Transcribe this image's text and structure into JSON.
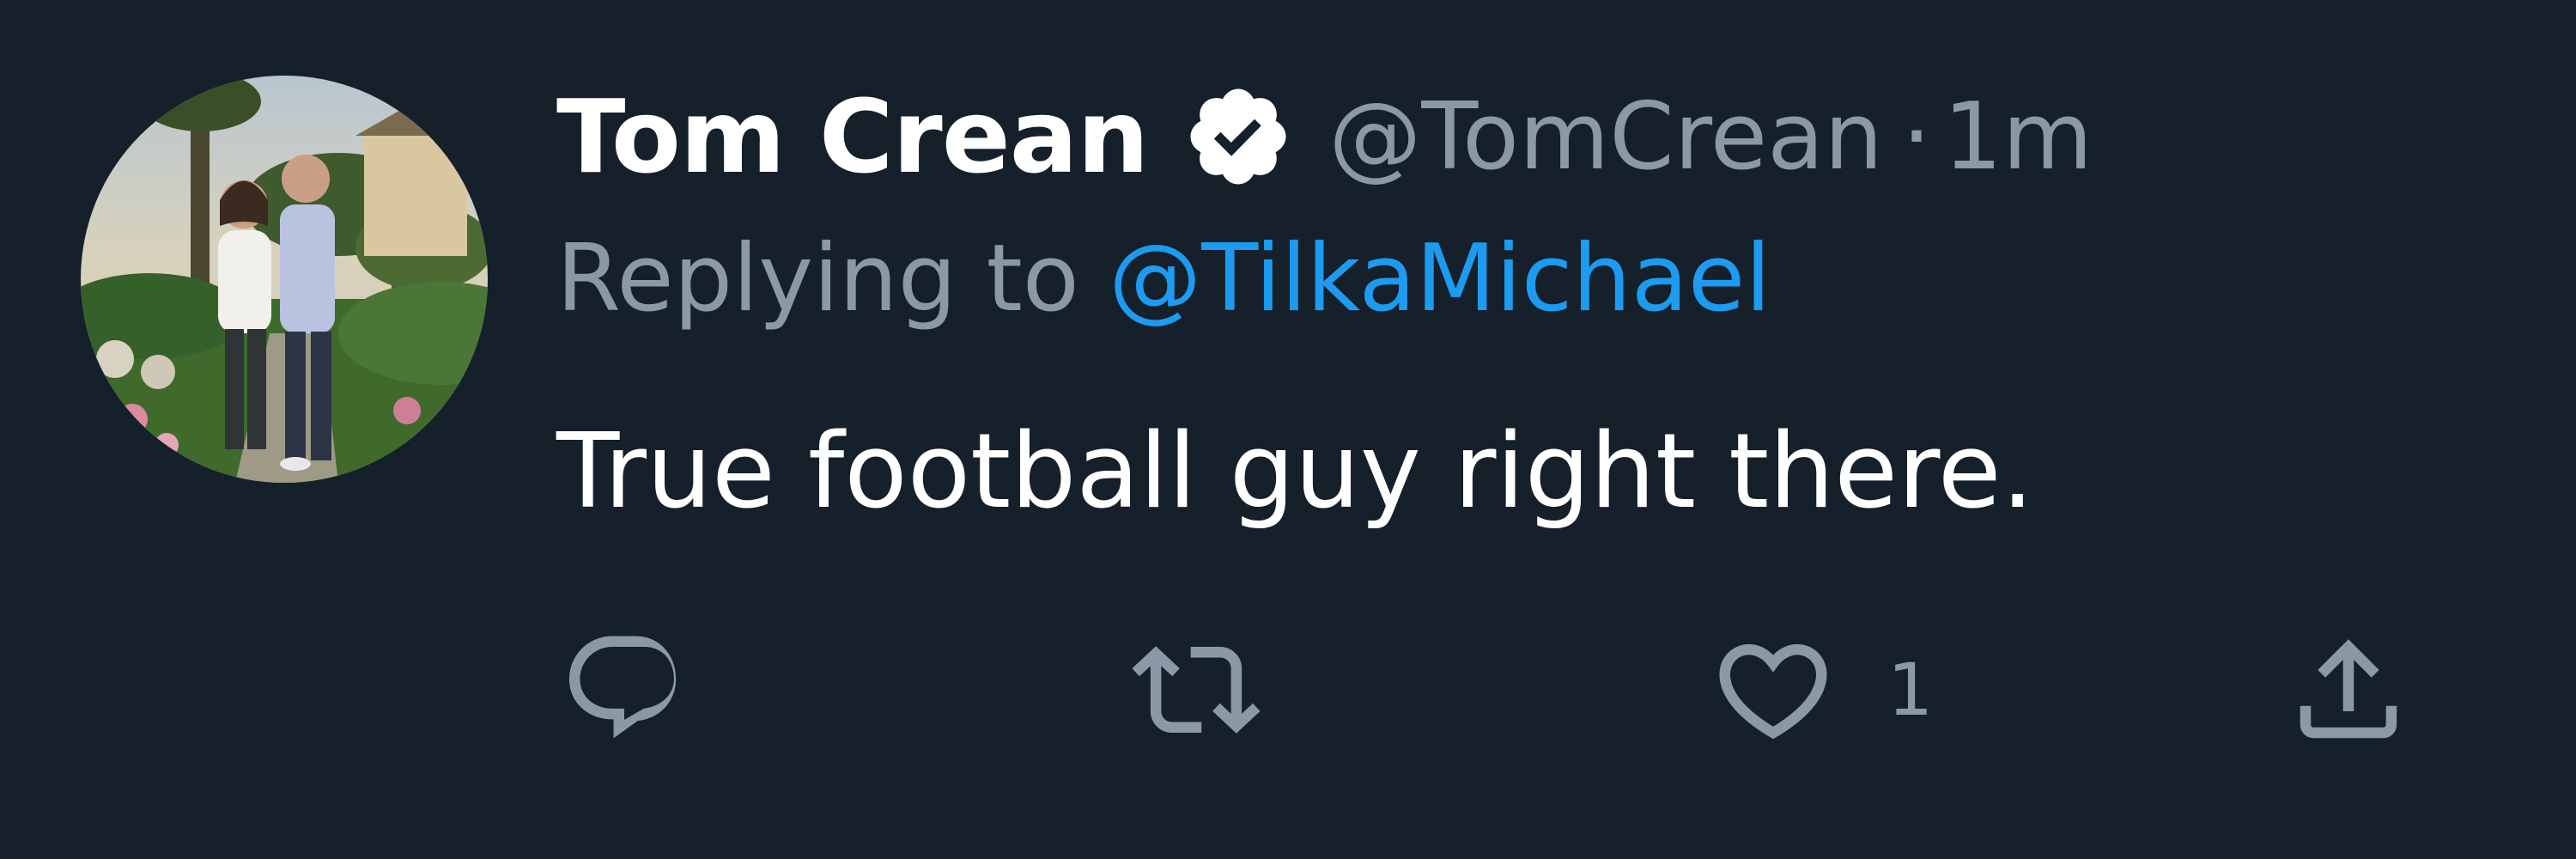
{
  "author": {
    "display_name": "Tom Crean",
    "handle": "@TomCrean",
    "separator": "·",
    "timestamp": "1m",
    "verified": true,
    "avatar": "photo of two people standing outdoors with palm trees"
  },
  "reply": {
    "prefix": "Replying to",
    "mention": "@TilkaMichael"
  },
  "tweet": {
    "text": "True football guy right there."
  },
  "actions": [
    {
      "name": "reply",
      "icon": "reply-icon",
      "count": ""
    },
    {
      "name": "retweet",
      "icon": "retweet-icon",
      "count": ""
    },
    {
      "name": "like",
      "icon": "heart-icon",
      "count": "1"
    },
    {
      "name": "share",
      "icon": "share-icon",
      "count": ""
    }
  ],
  "colors": {
    "background": "#15202b",
    "primary_text": "#ffffff",
    "secondary_text": "#8b98a5",
    "link": "#1d9bf0"
  }
}
